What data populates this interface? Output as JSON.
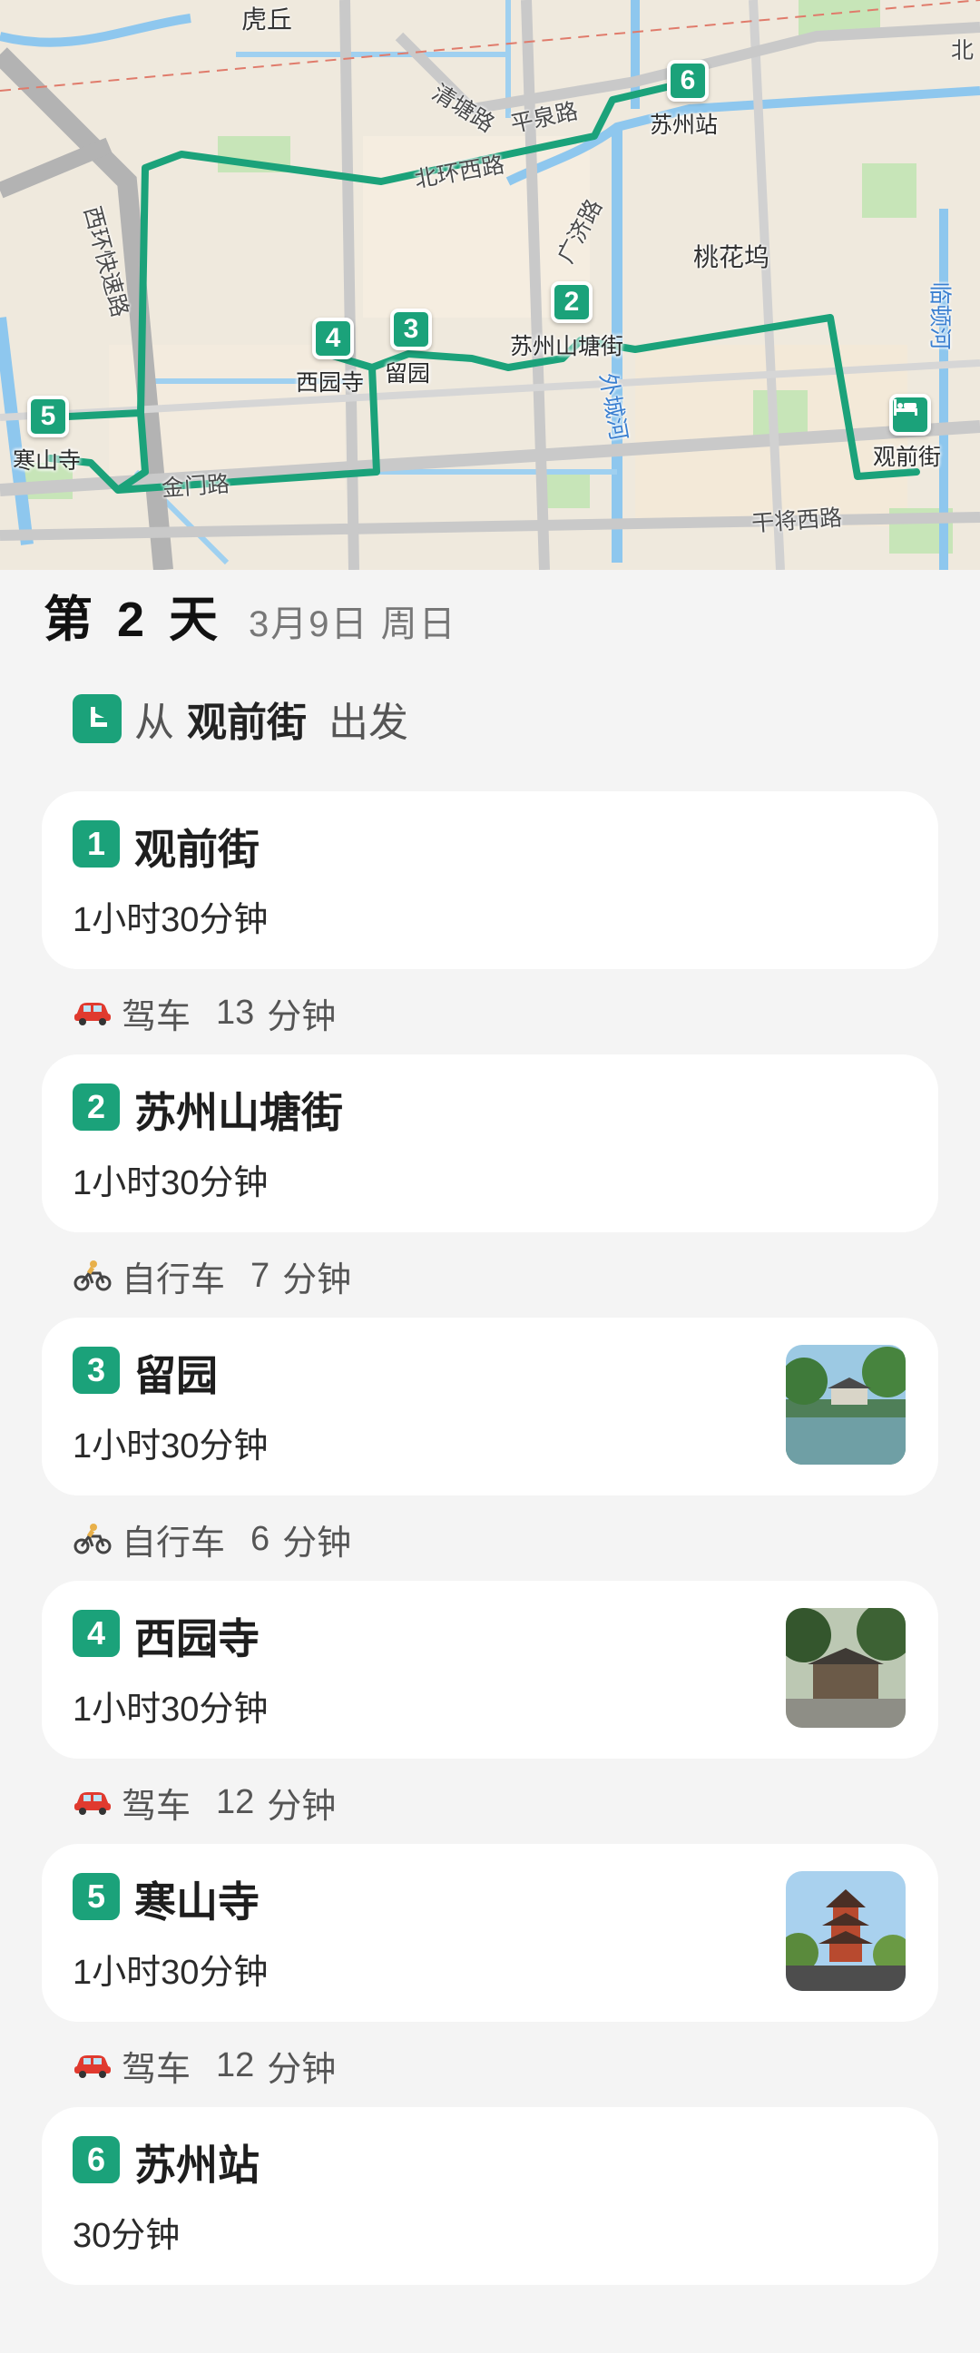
{
  "map": {
    "labels": {
      "huqiu": "虎丘",
      "qingtang_road": "清塘路",
      "pingquan_road": "平泉路",
      "beihuan_west_road": "北环西路",
      "xihuan_expressway": "西环快速路",
      "guangji_road": "广济路",
      "taohuawu": "桃花坞",
      "linton_river": "临顿河",
      "waicheng_river": "外城河",
      "jinmen_road": "金门路",
      "ganjiang_west_road": "干将西路",
      "bei_top_right": "北"
    },
    "pins": [
      {
        "num": "1",
        "label": "观前街"
      },
      {
        "num": "2",
        "label": "苏州山塘街"
      },
      {
        "num": "3",
        "label": "留园"
      },
      {
        "num": "4",
        "label": "西园寺"
      },
      {
        "num": "5",
        "label": "寒山寺"
      },
      {
        "num": "6",
        "label": "苏州站"
      }
    ],
    "route_color": "#1ba27a"
  },
  "day": {
    "title": "第 2 天",
    "date": "3月9日 周日"
  },
  "departure": {
    "prefix": "从",
    "place": "观前街",
    "suffix": "出发"
  },
  "stops": [
    {
      "num": "1",
      "name": "观前街",
      "duration": "1小时30分钟",
      "has_image": false
    },
    {
      "num": "2",
      "name": "苏州山塘街",
      "duration": "1小时30分钟",
      "has_image": false
    },
    {
      "num": "3",
      "name": "留园",
      "duration": "1小时30分钟",
      "has_image": true
    },
    {
      "num": "4",
      "name": "西园寺",
      "duration": "1小时30分钟",
      "has_image": true
    },
    {
      "num": "5",
      "name": "寒山寺",
      "duration": "1小时30分钟",
      "has_image": true
    },
    {
      "num": "6",
      "name": "苏州站",
      "duration": "30分钟",
      "has_image": false
    }
  ],
  "transits": [
    {
      "icon": "car-icon",
      "mode": "驾车",
      "time": "13",
      "unit": "分钟"
    },
    {
      "icon": "bicycle-icon",
      "mode": "自行车",
      "time": "7",
      "unit": "分钟"
    },
    {
      "icon": "bicycle-icon",
      "mode": "自行车",
      "time": "6",
      "unit": "分钟"
    },
    {
      "icon": "car-icon",
      "mode": "驾车",
      "time": "12",
      "unit": "分钟"
    },
    {
      "icon": "car-icon",
      "mode": "驾车",
      "time": "12",
      "unit": "分钟"
    }
  ]
}
